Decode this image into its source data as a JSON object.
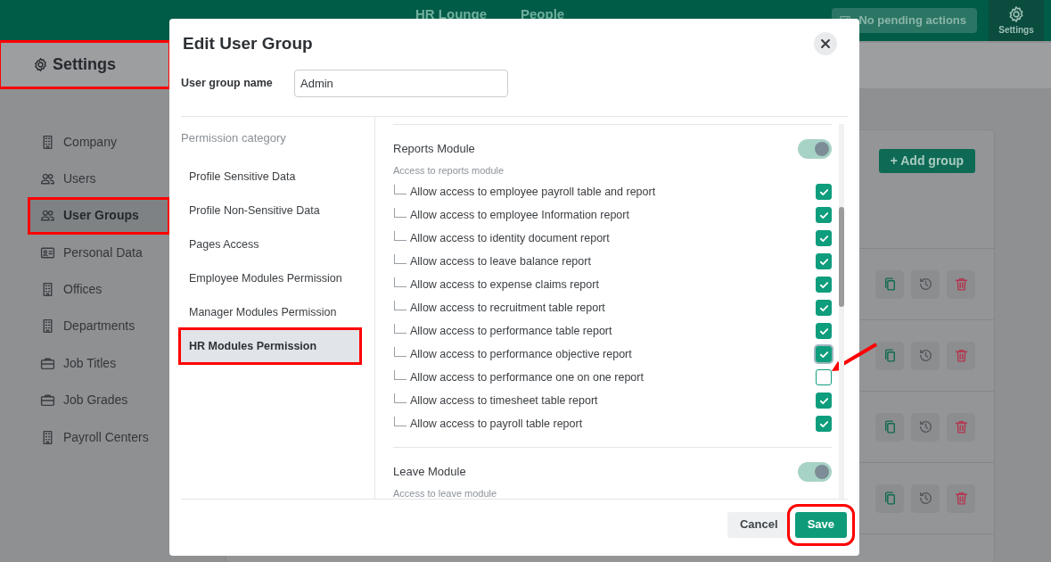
{
  "top_nav": {
    "links": [
      {
        "label": "HR Lounge"
      },
      {
        "label": "People"
      }
    ],
    "pending_button": "No pending actions",
    "settings_tab": "Settings"
  },
  "page_header": {
    "title": "Settings",
    "highlighted": true
  },
  "sidebar": {
    "items": [
      {
        "label": "Company",
        "kind": "building",
        "selected": false,
        "highlighted": false
      },
      {
        "label": "Users",
        "kind": "users",
        "selected": false,
        "highlighted": false
      },
      {
        "label": "User Groups",
        "kind": "users",
        "selected": true,
        "highlighted": true
      },
      {
        "label": "Personal Data",
        "kind": "idcard",
        "selected": false,
        "highlighted": false
      },
      {
        "label": "Offices",
        "kind": "building",
        "selected": false,
        "highlighted": false
      },
      {
        "label": "Departments",
        "kind": "building",
        "selected": false,
        "highlighted": false
      },
      {
        "label": "Job Titles",
        "kind": "briefcase",
        "selected": false,
        "highlighted": false
      },
      {
        "label": "Job Grades",
        "kind": "briefcase",
        "selected": false,
        "highlighted": false
      },
      {
        "label": "Payroll Centers",
        "kind": "building",
        "selected": false,
        "highlighted": false
      }
    ]
  },
  "groups_card": {
    "add_button": "+ Add group",
    "rows": [
      {
        "actions": [
          {
            "kind": "copy"
          },
          {
            "kind": "history"
          },
          {
            "kind": "delete"
          }
        ]
      },
      {
        "actions": [
          {
            "kind": "copy"
          },
          {
            "kind": "history"
          },
          {
            "kind": "delete"
          }
        ]
      },
      {
        "actions": [
          {
            "kind": "copy"
          },
          {
            "kind": "history"
          },
          {
            "kind": "delete"
          }
        ]
      },
      {
        "actions": [
          {
            "kind": "copy"
          },
          {
            "kind": "history"
          },
          {
            "kind": "delete"
          }
        ]
      }
    ]
  },
  "modal": {
    "title": "Edit User Group",
    "name_label": "User group name",
    "name_value": "Admin",
    "category_heading": "Permission category",
    "categories": [
      {
        "label": "Profile Sensitive Data",
        "selected": false,
        "highlighted": false
      },
      {
        "label": "Profile Non-Sensitive Data",
        "selected": false,
        "highlighted": false
      },
      {
        "label": "Pages Access",
        "selected": false,
        "highlighted": false
      },
      {
        "label": "Employee Modules Permission",
        "selected": false,
        "highlighted": false
      },
      {
        "label": "Manager Modules Permission",
        "selected": false,
        "highlighted": false
      },
      {
        "label": "HR Modules Permission",
        "selected": true,
        "highlighted": true
      }
    ],
    "modules": [
      {
        "title": "Reports Module",
        "description": "Access to reports module",
        "on": true,
        "permissions": [
          {
            "label": "Allow access to employee payroll table and report",
            "checked": true,
            "focused": false,
            "arrow": false
          },
          {
            "label": "Allow access to employee Information report",
            "checked": true,
            "focused": false,
            "arrow": false
          },
          {
            "label": "Allow access to identity document report",
            "checked": true,
            "focused": false,
            "arrow": false
          },
          {
            "label": "Allow access to leave balance report",
            "checked": true,
            "focused": false,
            "arrow": false
          },
          {
            "label": "Allow access to expense claims report",
            "checked": true,
            "focused": false,
            "arrow": false
          },
          {
            "label": "Allow access to recruitment table report",
            "checked": true,
            "focused": false,
            "arrow": false
          },
          {
            "label": "Allow access to performance table report",
            "checked": true,
            "focused": false,
            "arrow": false
          },
          {
            "label": "Allow access to performance objective report",
            "checked": true,
            "focused": true,
            "arrow": false
          },
          {
            "label": "Allow access to performance one on one report",
            "checked": false,
            "focused": false,
            "arrow": true
          },
          {
            "label": "Allow access to timesheet table report",
            "checked": true,
            "focused": false,
            "arrow": false
          },
          {
            "label": "Allow access to payroll table report",
            "checked": true,
            "focused": false,
            "arrow": false
          }
        ]
      },
      {
        "title": "Leave Module",
        "description": "Access to leave module",
        "on": true
      }
    ],
    "buttons": [
      {
        "label": "Cancel",
        "kind": "secondary",
        "highlighted": false
      },
      {
        "label": "Save",
        "kind": "primary",
        "highlighted": true
      }
    ]
  }
}
